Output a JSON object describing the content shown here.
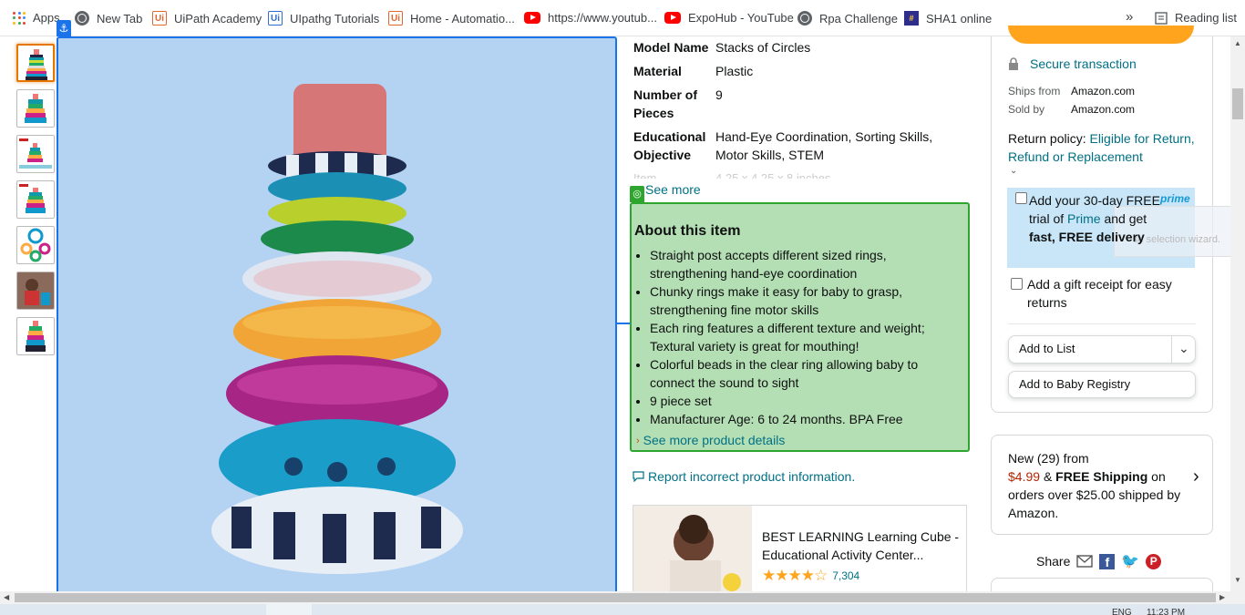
{
  "bookmarks": {
    "items": [
      {
        "label": "Apps",
        "icon": "apps-grid-icon"
      },
      {
        "label": "New Tab",
        "icon": "globe-icon"
      },
      {
        "label": "UiPath Academy",
        "icon": "uipath-icon"
      },
      {
        "label": "UIpathg Tutorials",
        "icon": "uipath-blue-icon"
      },
      {
        "label": "Home - Automatio...",
        "icon": "uipath-icon"
      },
      {
        "label": "https://www.youtub...",
        "icon": "youtube-icon"
      },
      {
        "label": "ExpoHub - YouTube",
        "icon": "youtube-icon"
      },
      {
        "label": "Rpa Challenge",
        "icon": "globe-icon"
      },
      {
        "label": "SHA1 online",
        "icon": "sha-icon"
      }
    ],
    "overflow": "»",
    "reading_list": "Reading list"
  },
  "specs": [
    {
      "label": "Model Name",
      "value": "Stacks of Circles"
    },
    {
      "label": "Material",
      "value": "Plastic"
    },
    {
      "label": "Number of Pieces",
      "value": "9"
    },
    {
      "label": "Educational Objective",
      "value": "Hand-Eye Coordination, Sorting Skills, Motor Skills, STEM"
    },
    {
      "label": "Item",
      "value": "4.25 x 4.25 x 8 inches"
    }
  ],
  "see_more": "See more",
  "about": {
    "title": "About this item",
    "bullets": [
      "Straight post accepts different sized rings, strengthening hand-eye coordination",
      "Chunky rings make it easy for baby to grasp, strengthening fine motor skills",
      "Each ring features a different texture and weight; Textural variety is great for mouthing!",
      "Colorful beads in the clear ring allowing baby to connect the sound to sight",
      "9 piece set",
      "Manufacturer Age: 6 to 24 months. BPA Free"
    ],
    "see_more_details": "See more product details"
  },
  "report_link": "Report incorrect product information.",
  "related": {
    "title": "BEST LEARNING Learning Cube - Educational Activity Center...",
    "rating_count": "7,304",
    "stars": 4.5
  },
  "buybox": {
    "secure": "Secure transaction",
    "ships_from_label": "Ships from",
    "ships_from": "Amazon.com",
    "sold_by_label": "Sold by",
    "sold_by": "Amazon.com",
    "return_policy_label": "Return policy:",
    "return_policy_link": "Eligible for Return, Refund or Replacement",
    "prime_trial_1": "Add your 30-day FREE trial of",
    "prime_word": "Prime",
    "prime_trial_2": "and get",
    "prime_trial_bold": "fast, FREE delivery",
    "prime_logo": "prime",
    "overlay_text": "se selection wizard.",
    "gift_receipt": "Add a gift receipt for easy returns",
    "add_to_list": "Add to List",
    "add_to_registry": "Add to Baby Registry"
  },
  "new_offers": {
    "line1": "New (29) from",
    "price": "$4.99",
    "amp": "&",
    "free_shipping": "FREE Shipping",
    "rest": "on orders over $25.00 shipped by Amazon."
  },
  "share": {
    "label": "Share"
  },
  "taskbar": {
    "lang": "ENG",
    "time": "11:23 PM"
  },
  "colors": {
    "image_highlight": "#b4d2f2",
    "about_highlight": "#b4deb4",
    "link": "#007185",
    "price": "#b12704"
  }
}
